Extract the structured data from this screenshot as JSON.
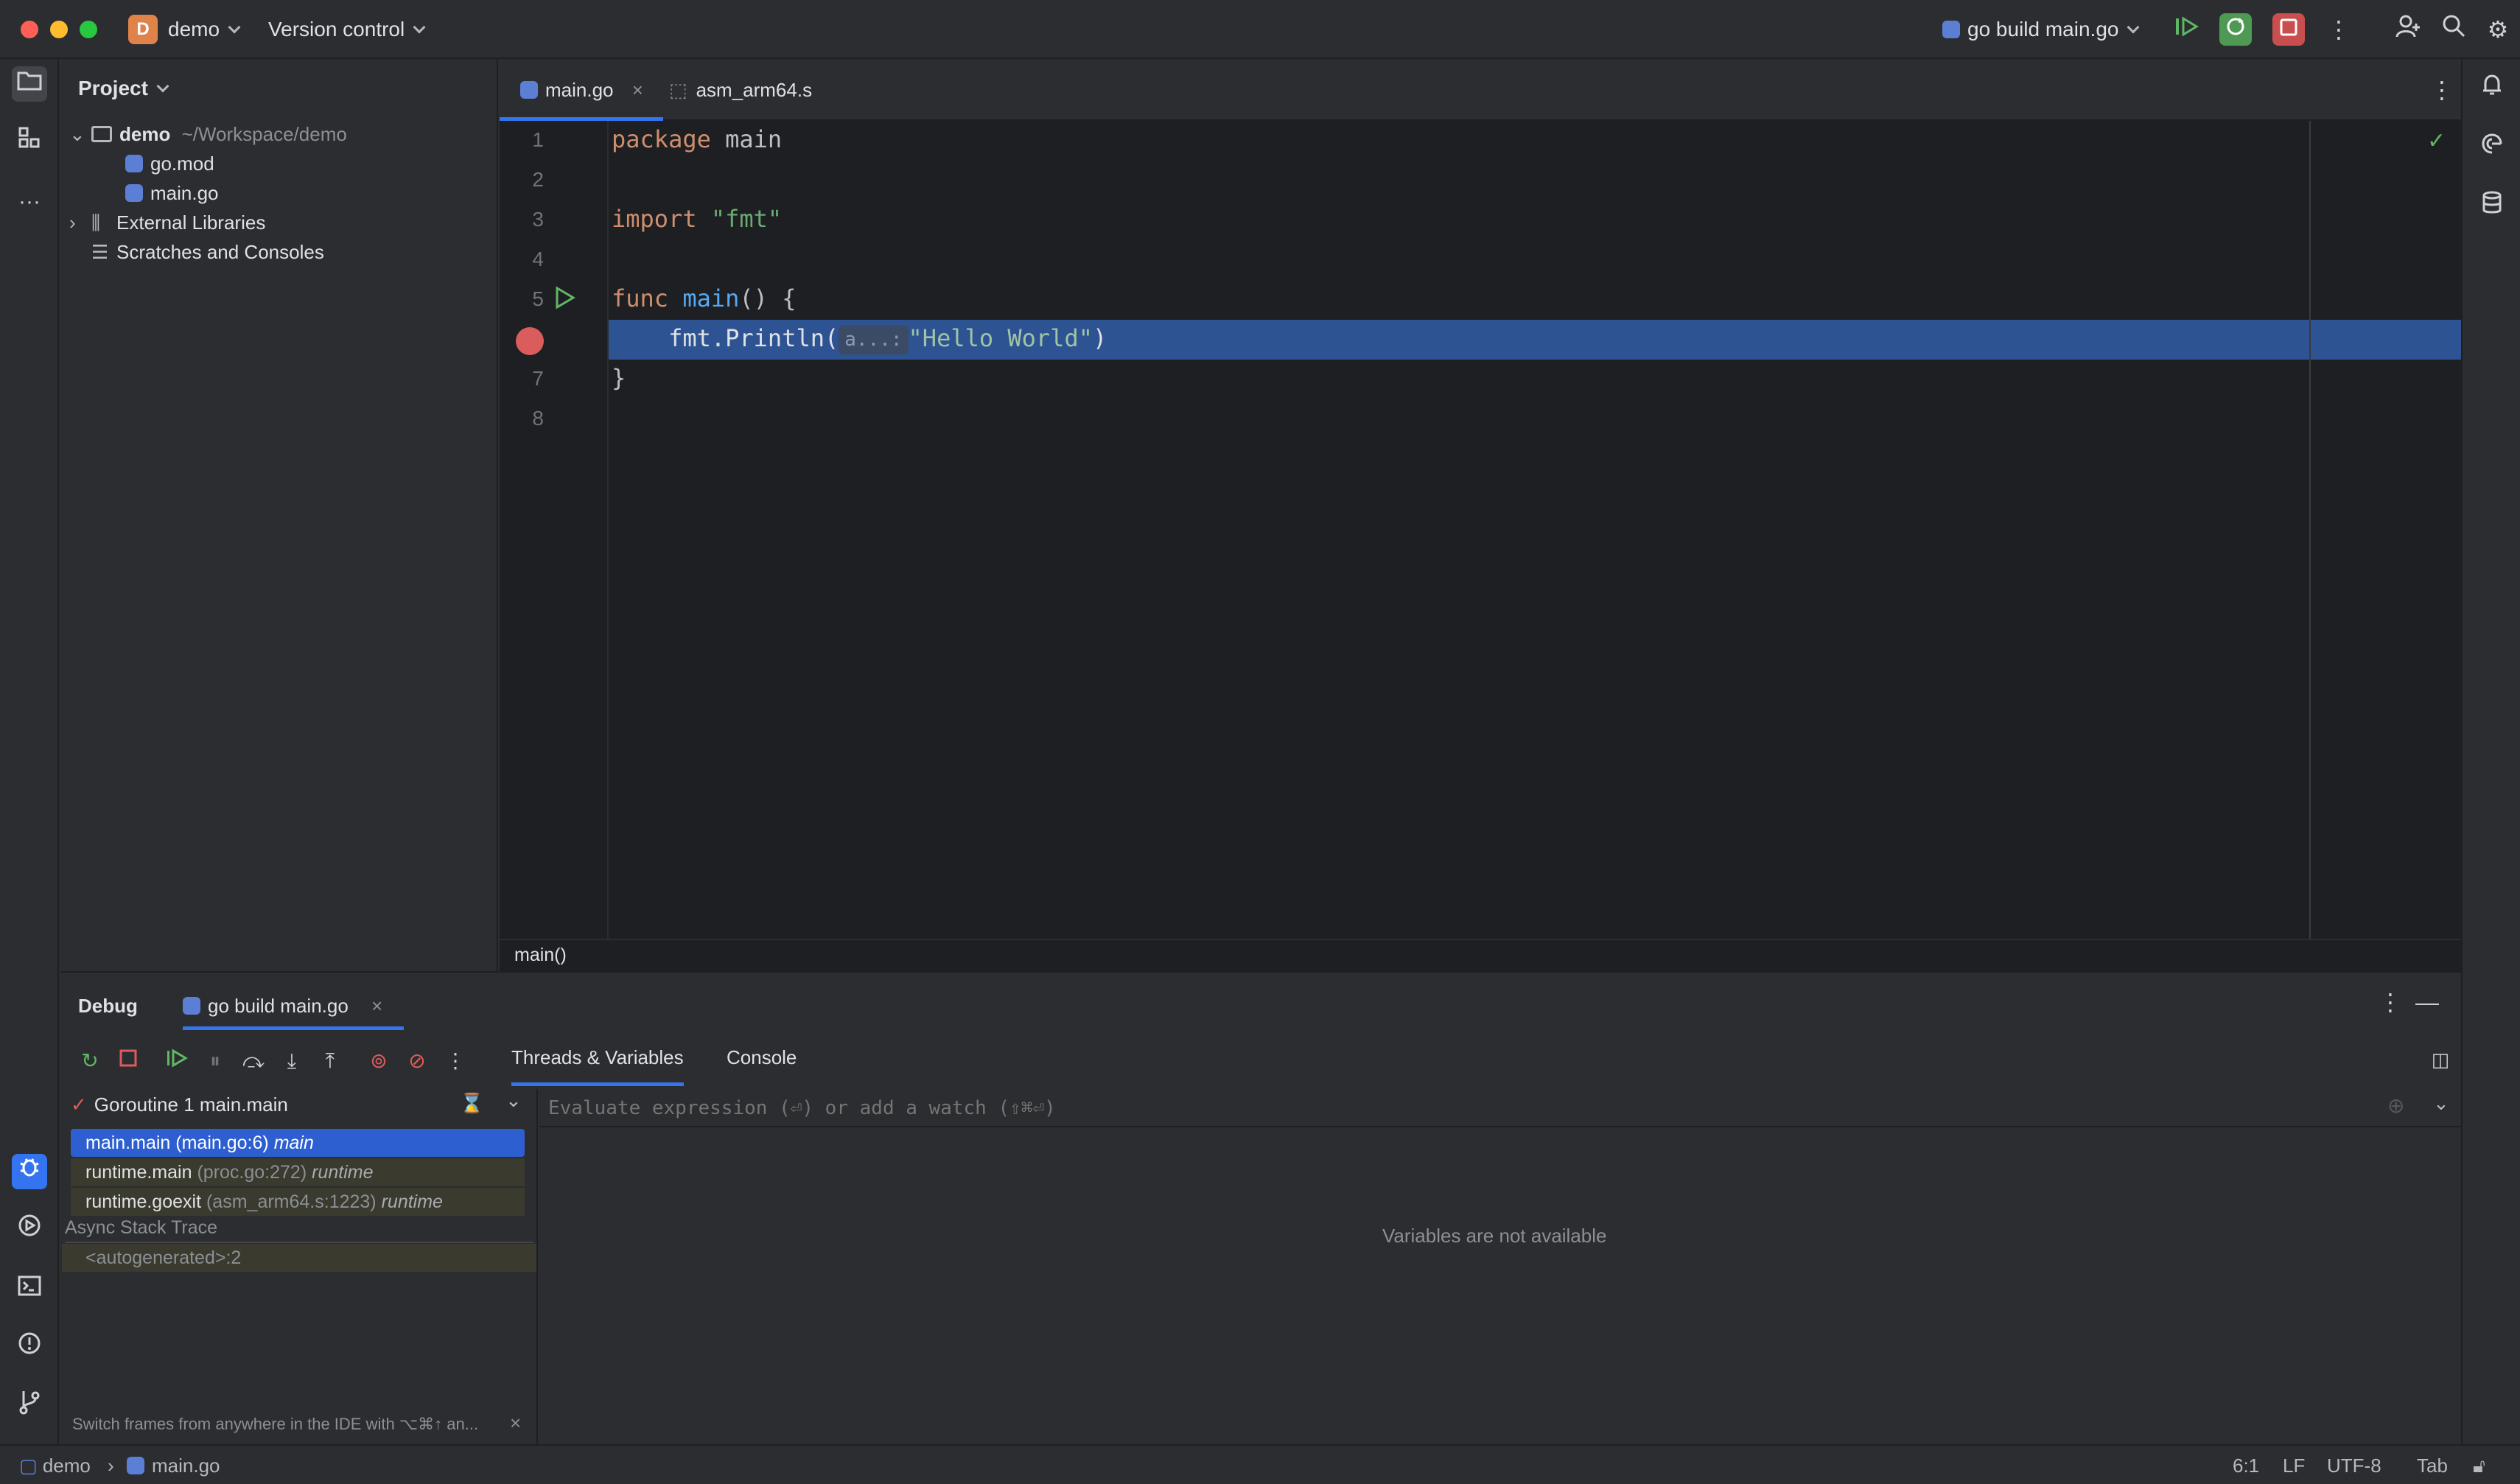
{
  "titlebar": {
    "project_badge": "D",
    "project_name": "demo",
    "vcs_label": "Version control",
    "run_config": "go build main.go"
  },
  "project_panel": {
    "title": "Project",
    "tree": [
      {
        "label": "demo",
        "hint": "~/Workspace/demo"
      },
      {
        "label": "go.mod"
      },
      {
        "label": "main.go"
      },
      {
        "label": "External Libraries"
      },
      {
        "label": "Scratches and Consoles"
      }
    ]
  },
  "editor": {
    "tabs": [
      {
        "label": "main.go",
        "active": true
      },
      {
        "label": "asm_arm64.s",
        "active": false
      }
    ],
    "line_numbers": [
      "1",
      "2",
      "3",
      "4",
      "5",
      "6",
      "7",
      "8"
    ],
    "code": {
      "l1_kw": "package",
      "l1_rest": " main",
      "l3_kw": "import",
      "l3_str": " \"fmt\"",
      "l5_kw": "func",
      "l5_fn": " main",
      "l5_rest": "() {",
      "l6_pre": "    fmt.Println(",
      "l6_hint": "a...:",
      "l6_str": "\"Hello World\"",
      "l6_post": ")",
      "l7": "}"
    },
    "breadcrumb": "main()"
  },
  "debug": {
    "title": "Debug",
    "session_tab": "go build main.go",
    "subtabs": [
      "Threads & Variables",
      "Console"
    ],
    "goroutine": "Goroutine 1 main.main",
    "frames": [
      {
        "fn": "main.main",
        "loc": "(main.go:6)",
        "pkg": "main"
      },
      {
        "fn": "runtime.main",
        "loc": "(proc.go:272)",
        "pkg": "runtime"
      },
      {
        "fn": "runtime.goexit",
        "loc": "(asm_arm64.s:1223)",
        "pkg": "runtime"
      }
    ],
    "async_label": "Async Stack Trace",
    "async_frame": "<autogenerated>:2",
    "tip": "Switch frames from anywhere in the IDE with ⌥⌘↑ an...",
    "eval_placeholder": "Evaluate expression (⏎) or add a watch (⇧⌘⏎)",
    "vars_empty": "Variables are not available"
  },
  "statusbar": {
    "project": "demo",
    "file": "main.go",
    "position": "6:1",
    "line_sep": "LF",
    "encoding": "UTF-8",
    "indent": "Tab"
  },
  "colors": {
    "accent": "#3574f0",
    "breakpoint": "#db5c5c",
    "run_green": "#5fb865",
    "selection": "#2e5393"
  }
}
